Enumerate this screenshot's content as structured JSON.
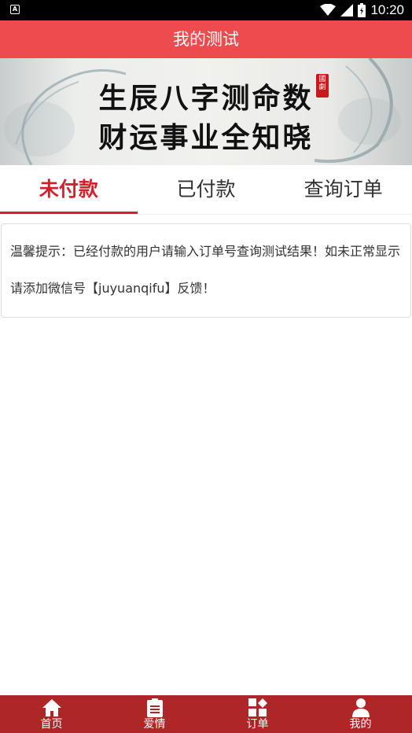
{
  "status_bar": {
    "time": "10:20",
    "left_badge": "A"
  },
  "header": {
    "title": "我的测试"
  },
  "banner": {
    "line1": "生辰八字测命数",
    "line2": "财运事业全知晓",
    "seal_text": "國劇"
  },
  "tabs": [
    {
      "label": "未付款",
      "active": true
    },
    {
      "label": "已付款",
      "active": false
    },
    {
      "label": "查询订单",
      "active": false
    }
  ],
  "notice": {
    "text": "温馨提示：已经付款的用户请输入订单号查询测试结果！如未正常显示请添加微信号【juyuanqifu】反馈！"
  },
  "bottom_nav": [
    {
      "label": "首页",
      "icon": "home-icon"
    },
    {
      "label": "爱情",
      "icon": "clipboard-icon"
    },
    {
      "label": "订单",
      "icon": "grid-icon"
    },
    {
      "label": "我的",
      "icon": "user-icon"
    }
  ],
  "colors": {
    "header": "#ee4b4e",
    "accent": "#d4202c",
    "bottom_nav": "#ae2727"
  }
}
